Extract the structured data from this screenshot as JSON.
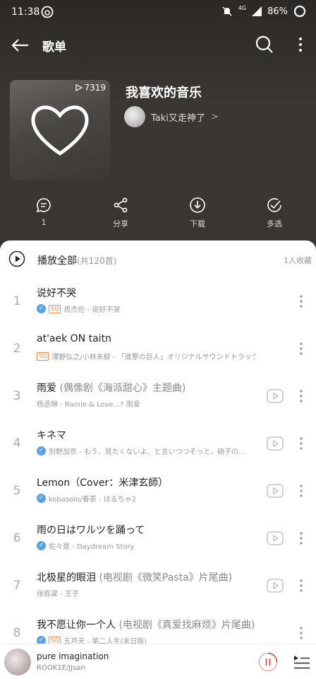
{
  "statusbar": {
    "time": "11:38",
    "network": "4G",
    "battery": "86%"
  },
  "topbar": {
    "title": "歌单"
  },
  "playlist": {
    "play_count": "7319",
    "title": "我喜欢的音乐",
    "creator": "Taki又走神了",
    "creator_chevron": ">"
  },
  "actions": {
    "comment_label": "1",
    "share_label": "分享",
    "download_label": "下载",
    "multiselect_label": "多选"
  },
  "list": {
    "play_all_label": "播放全部",
    "play_all_count": "(共120首)",
    "collect_count": "1人收藏",
    "songs": [
      {
        "index": "1",
        "title": "说好不哭",
        "subtitle": "",
        "badges": "v,sq",
        "meta": "周杰伦 - 说好不哭"
      },
      {
        "index": "2",
        "title": "at'aek ON taitn",
        "subtitle": "",
        "badges": "sq",
        "meta": "澤野弘之/小林未郁 - 「進撃の巨人」オリジナルサウンドトラック"
      },
      {
        "index": "3",
        "title": "雨爱",
        "subtitle": " (偶像剧《海派甜心》主题曲)",
        "badges": "",
        "meta": "杨丞琳 - Rainie & Love...? 雨爱"
      },
      {
        "index": "4",
        "title": "キネマ",
        "subtitle": "",
        "badges": "v",
        "meta": "別野加奈 - もう、見たくないよ、と言いつつそっと、硝子の..."
      },
      {
        "index": "5",
        "title": "Lemon（Cover：米津玄師）",
        "subtitle": "",
        "badges": "v",
        "meta": "kobasolo/春茶 - はるちゃ2"
      },
      {
        "index": "6",
        "title": "雨の日はワルツを踊って",
        "subtitle": "",
        "badges": "v",
        "meta": "佐々是 - Daydream Story"
      },
      {
        "index": "7",
        "title": "北极星的眼泪",
        "subtitle": " (电视剧《微笑Pasta》片尾曲)",
        "badges": "",
        "meta": "张栋梁 - 王子"
      },
      {
        "index": "8",
        "title": "我不愿让你一个人",
        "subtitle": " (电视剧《真爱找麻烦》片尾曲)",
        "badges": "v,sq",
        "meta": "五月天 - 第二人生(末日版)"
      }
    ]
  },
  "player": {
    "title": "pure imagination",
    "artist": "ROOK1E/JJsan"
  },
  "colors": {
    "header_bg": "#2b2826",
    "accent": "#d33a31",
    "verified": "#5aa0e6",
    "sq": "#e85"
  }
}
